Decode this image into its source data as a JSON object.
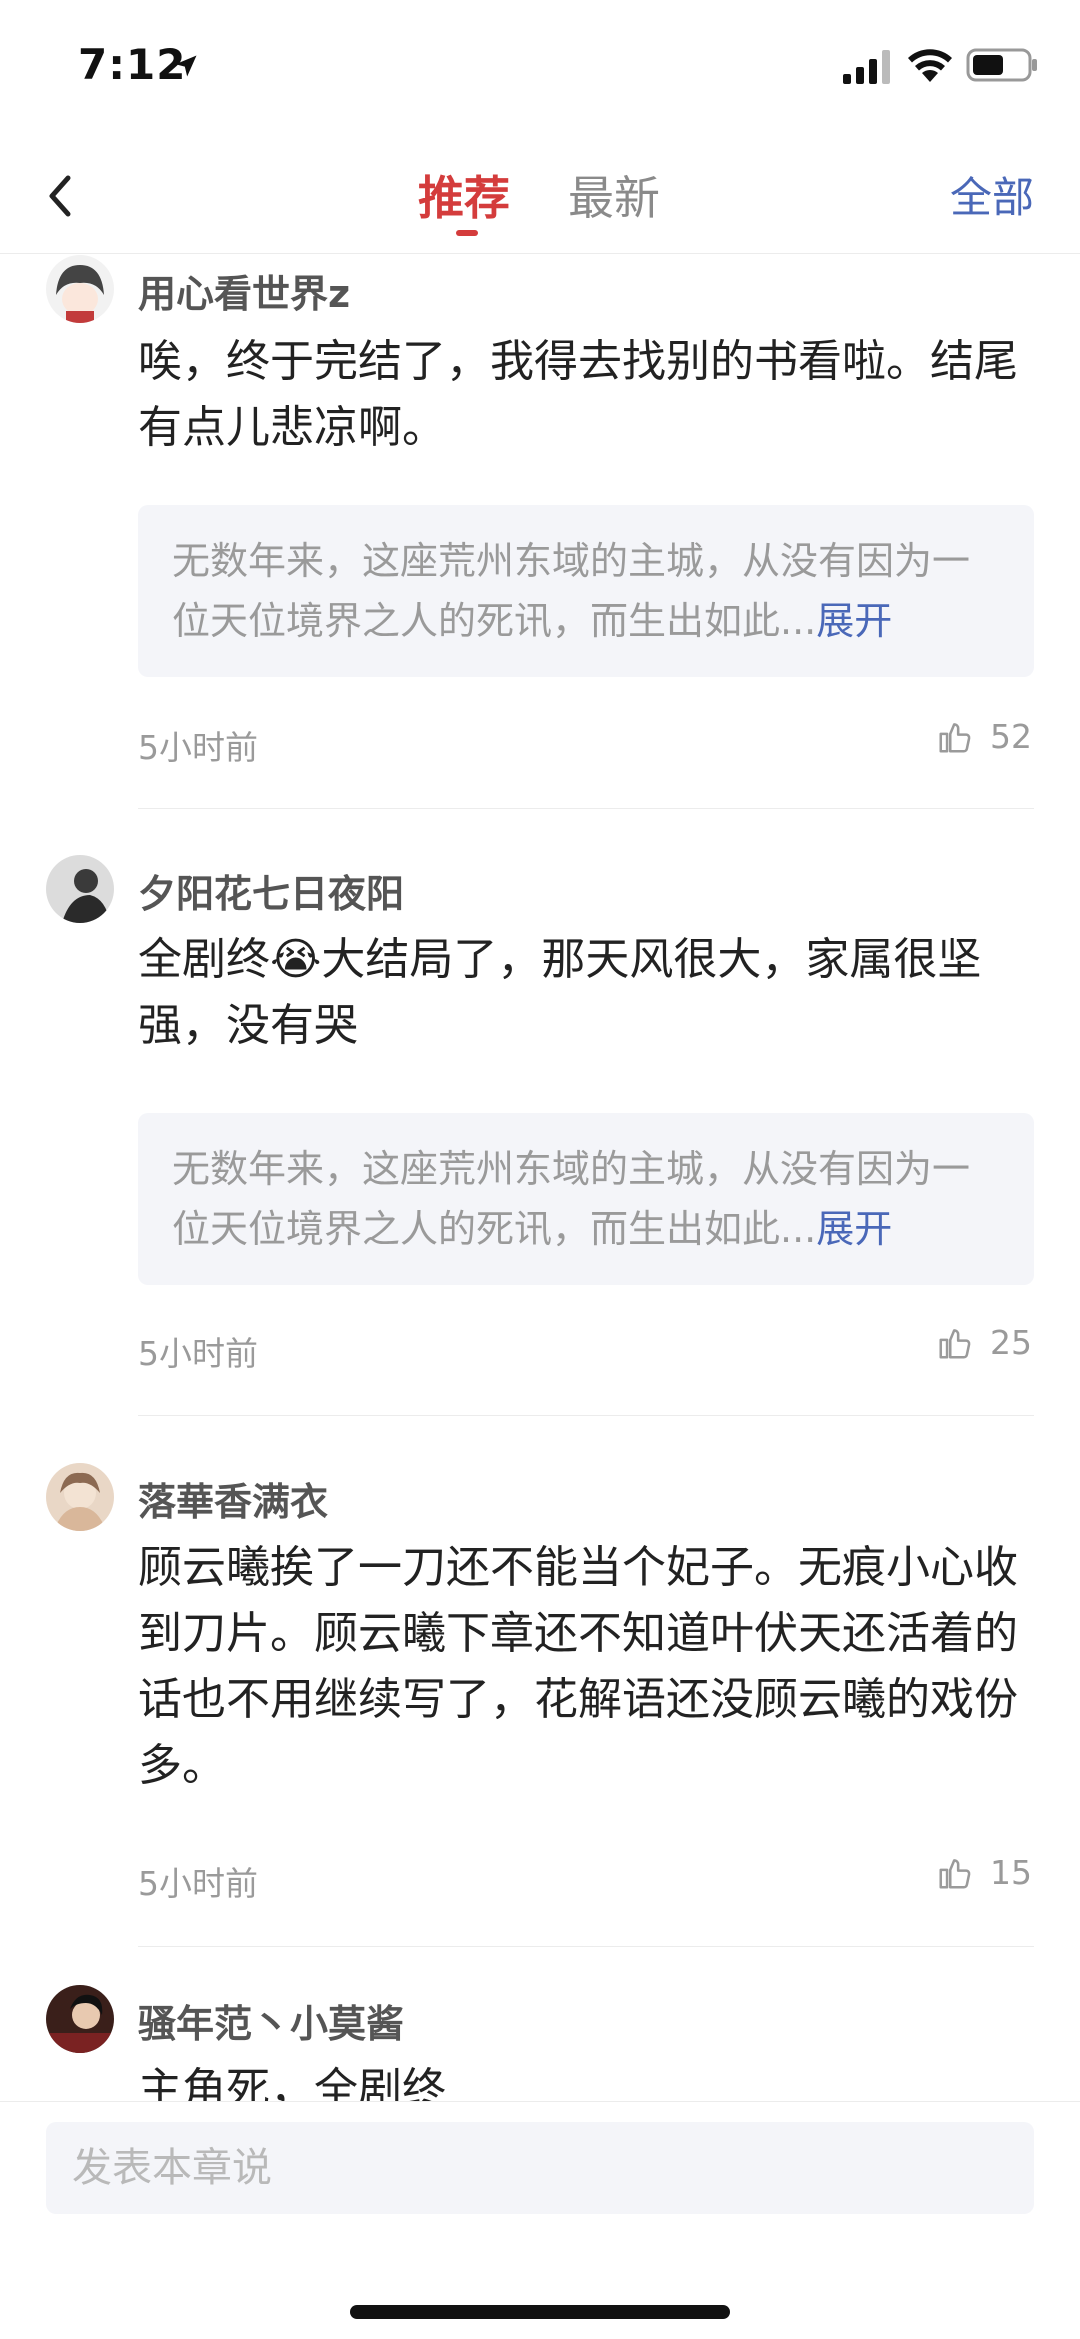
{
  "status_bar": {
    "time": "7:12"
  },
  "nav": {
    "tabs": [
      {
        "label": "推荐",
        "active": true
      },
      {
        "label": "最新",
        "active": false
      }
    ],
    "all_label": "全部"
  },
  "comments": [
    {
      "username": "用心看世界z",
      "content": "唉，终于完结了，我得去找别的书看啦。结尾有点儿悲凉啊。",
      "quote": "无数年来，这座荒州东域的主城，从没有因为一位天位境界之人的死讯，而生出如此...",
      "expand_label": "展开",
      "time": "5小时前",
      "likes": "52"
    },
    {
      "username": "夕阳花七日夜阳",
      "content_before": "全剧终",
      "emoji": "😭",
      "content_after": "大结局了，那天风很大，家属很坚强，没有哭",
      "quote": "无数年来，这座荒州东域的主城，从没有因为一位天位境界之人的死讯，而生出如此...",
      "expand_label": "展开",
      "time": "5小时前",
      "likes": "25"
    },
    {
      "username": "落華香满衣",
      "content": "顾云曦挨了一刀还不能当个妃子。无痕小心收到刀片。顾云曦下章还不知道叶伏天还活着的话也不用继续写了，花解语还没顾云曦的戏份多。",
      "time": "5小时前",
      "likes": "15"
    },
    {
      "username": "骚年范丶小莫酱",
      "content": "主角死，全剧终"
    }
  ],
  "input": {
    "placeholder": "发表本章说"
  },
  "colors": {
    "accent_red": "#d43c3c",
    "link_blue": "#4a68b8",
    "quote_bg": "#f4f5f9"
  }
}
